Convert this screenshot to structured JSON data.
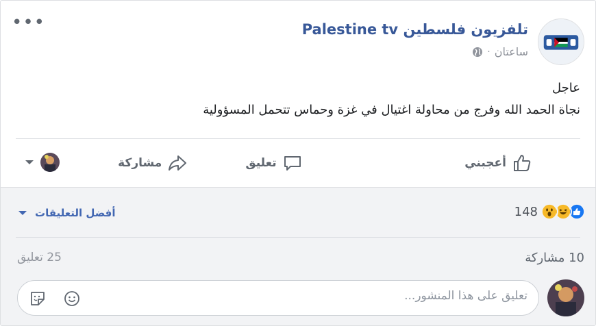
{
  "post": {
    "page_name": "تلفزيون فلسطين Palestine tv",
    "time": "ساعتان",
    "separator": "·",
    "privacy_icon": "globe-icon",
    "avatar_logo_text": "فلسطين",
    "line1": "عاجل",
    "line2": "نجاة الحمد الله وفرج من محاولة اغتيال في غزة وحماس تتحمل المسؤولية",
    "more_label": "•••"
  },
  "actions": {
    "like": "أعجبني",
    "comment": "تعليق",
    "share": "مشاركة"
  },
  "reactions": {
    "count": "148",
    "icons": [
      "like-reaction-icon",
      "haha-reaction-icon",
      "wow-reaction-icon"
    ],
    "best_comments": "أفضل التعليقات"
  },
  "stats": {
    "shares": "10 مشاركة",
    "comments": "25 تعليق"
  },
  "comment_box": {
    "placeholder": "تعليق على هذا المنشور..."
  },
  "colors": {
    "brand_blue": "#385898",
    "link_blue": "#4267b2",
    "muted": "#90949c",
    "zone_bg": "#f2f3f5"
  }
}
